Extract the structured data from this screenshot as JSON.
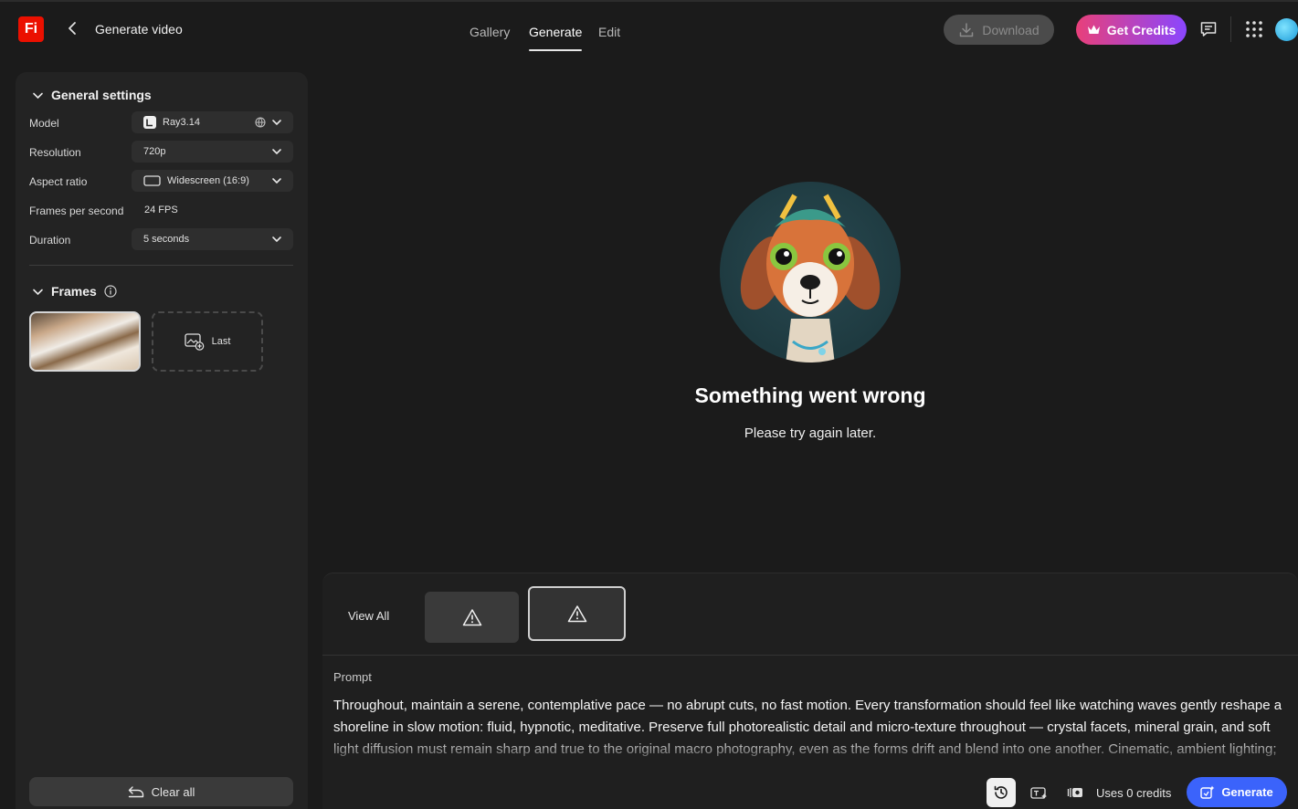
{
  "app": {
    "logo_text": "Fi",
    "title": "Generate video",
    "accent": "#eb1000"
  },
  "nav": {
    "tabs": [
      {
        "label": "Gallery"
      },
      {
        "label": "Generate"
      },
      {
        "label": "Edit"
      }
    ],
    "active": "Generate"
  },
  "topbar": {
    "download_label": "Download",
    "credits_label": "Get Credits"
  },
  "sidebar": {
    "general_settings_label": "General settings",
    "rows": {
      "model": {
        "label": "Model",
        "value": "Ray3.14"
      },
      "resolution": {
        "label": "Resolution",
        "value": "720p"
      },
      "aspect_ratio": {
        "label": "Aspect ratio",
        "value": "Widescreen (16:9)"
      },
      "fps": {
        "label": "Frames per second",
        "value": "24 FPS"
      },
      "duration": {
        "label": "Duration",
        "value": "5 seconds"
      }
    },
    "frames_label": "Frames",
    "last_frame_label": "Last",
    "clear_all_label": "Clear all"
  },
  "main": {
    "error_title": "Something went wrong",
    "error_subtitle": "Please try again later."
  },
  "bottom": {
    "view_all_label": "View All",
    "prompt_label": "Prompt",
    "prompt_text": "Throughout, maintain a serene, contemplative pace — no abrupt cuts, no fast motion. Every transformation should feel like watching waves gently reshape a shoreline in slow motion: fluid, hypnotic, meditative. Preserve full photorealistic detail and micro-texture throughout — crystal facets, mineral grain, and soft light diffusion must remain sharp and true to the original macro photography, even as the forms drift and blend into one another. Cinematic, ambient lighting; muted",
    "credits_text": "Uses 0 credits",
    "generate_label": "Generate"
  },
  "colors": {
    "generate_button": "#3b63fb",
    "credits_gradient_start": "#e8407a",
    "credits_gradient_end": "#8a46ff"
  }
}
